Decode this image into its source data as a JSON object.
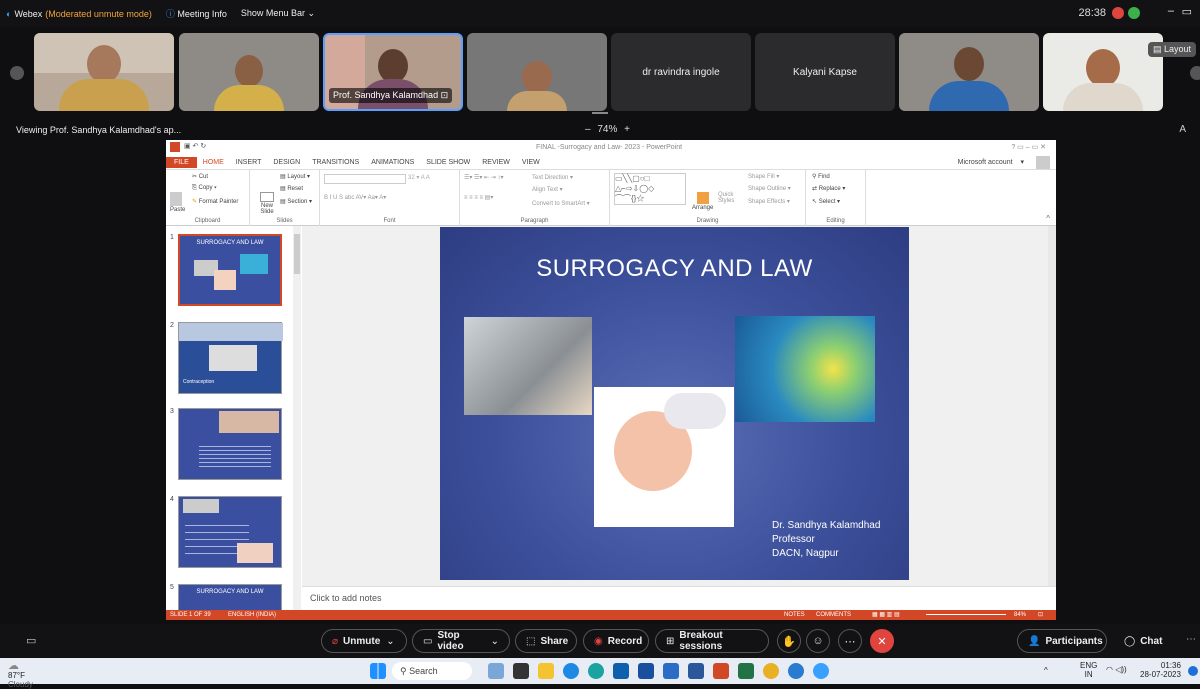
{
  "topbar": {
    "app": "Webex",
    "mode": "(Moderated unmute mode)",
    "meeting_info": "Meeting Info",
    "show_menu_bar": "Show Menu Bar",
    "timer": "28:38"
  },
  "participants": [
    {
      "name": ""
    },
    {
      "name": ""
    },
    {
      "name": "Prof. Sandhya Kalamdhad"
    },
    {
      "name": ""
    },
    {
      "name": "dr ravindra ingole"
    },
    {
      "name": "Kalyani Kapse"
    },
    {
      "name": ""
    },
    {
      "name": ""
    }
  ],
  "layout_label": "Layout",
  "viewing": "Viewing Prof. Sandhya Kalamdhad's ap...",
  "zoom": "74%",
  "ppt": {
    "window_title": "FINAL -Surrogacy and Law- 2023 - PowerPoint",
    "account": "Microsoft account",
    "menus": [
      "FILE",
      "HOME",
      "INSERT",
      "DESIGN",
      "TRANSITIONS",
      "ANIMATIONS",
      "SLIDE SHOW",
      "REVIEW",
      "VIEW"
    ],
    "ribbon": {
      "clipboard": {
        "label": "Clipboard",
        "paste": "Paste",
        "cut": "Cut",
        "copy": "Copy",
        "format_painter": "Format Painter"
      },
      "slides": {
        "label": "Slides",
        "new_slide": "New Slide",
        "layout": "Layout",
        "reset": "Reset",
        "section": "Section"
      },
      "font": {
        "label": "Font",
        "size": "32"
      },
      "paragraph": {
        "label": "Paragraph",
        "text_direction": "Text Direction",
        "align_text": "Align Text",
        "smartart": "Convert to SmartArt"
      },
      "drawing": {
        "label": "Drawing",
        "arrange": "Arrange",
        "quick_styles": "Quick Styles",
        "shape_fill": "Shape Fill",
        "shape_outline": "Shape Outline",
        "shape_effects": "Shape Effects"
      },
      "editing": {
        "label": "Editing",
        "find": "Find",
        "replace": "Replace",
        "select": "Select"
      }
    },
    "thumbnails": [
      {
        "num": "1",
        "title": "SURROGACY AND LAW"
      },
      {
        "num": "2",
        "title": "Contraception"
      },
      {
        "num": "3",
        "title": ""
      },
      {
        "num": "4",
        "title": ""
      },
      {
        "num": "5",
        "title": "SURROGACY AND LAW"
      }
    ],
    "slide": {
      "title": "SURROGACY AND LAW",
      "author": "Dr. Sandhya Kalamdhad",
      "role": "Professor",
      "org": "DACN, Nagpur"
    },
    "notes_placeholder": "Click to add notes",
    "status": {
      "slide_of": "SLIDE 1 OF 39",
      "language": "ENGLISH (INDIA)",
      "notes": "NOTES",
      "comments": "COMMENTS",
      "zoom": "84%"
    }
  },
  "controls": {
    "unmute": "Unmute",
    "stop_video": "Stop video",
    "share": "Share",
    "record": "Record",
    "breakout": "Breakout sessions",
    "participants": "Participants",
    "chat": "Chat"
  },
  "taskbar": {
    "temp": "87°F",
    "weather": "Cloudy",
    "search": "Search",
    "lang1": "ENG",
    "lang2": "IN",
    "time": "01:36",
    "date": "28-07-2023"
  }
}
